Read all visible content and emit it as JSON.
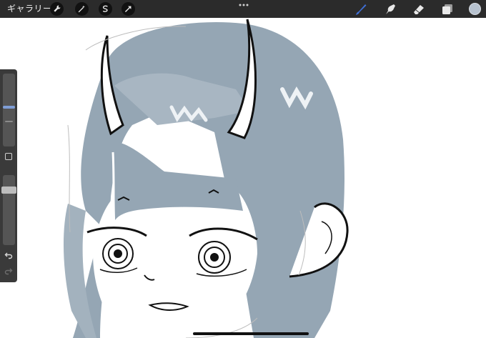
{
  "topbar": {
    "gallery_label": "ギャラリー",
    "left_tools": [
      {
        "icon": "wrench-icon",
        "name": "actions"
      },
      {
        "icon": "magic-wand-icon",
        "name": "adjustments"
      },
      {
        "icon": "selection-icon",
        "name": "selection"
      },
      {
        "icon": "transform-arrow-icon",
        "name": "transform"
      }
    ],
    "right_tools": [
      {
        "icon": "brush-icon",
        "name": "brush",
        "active": true
      },
      {
        "icon": "smudge-icon",
        "name": "smudge"
      },
      {
        "icon": "eraser-icon",
        "name": "eraser"
      },
      {
        "icon": "layers-icon",
        "name": "layers"
      }
    ],
    "current_color": "#b7c2cf"
  },
  "sidebar": {
    "brush_size": 0.5,
    "opacity": 0.8
  },
  "colors": {
    "topbar_bg": "#2b2b2b",
    "active_tool": "#3f6fd6",
    "hair": "#95a6b4",
    "ink": "#111111"
  }
}
